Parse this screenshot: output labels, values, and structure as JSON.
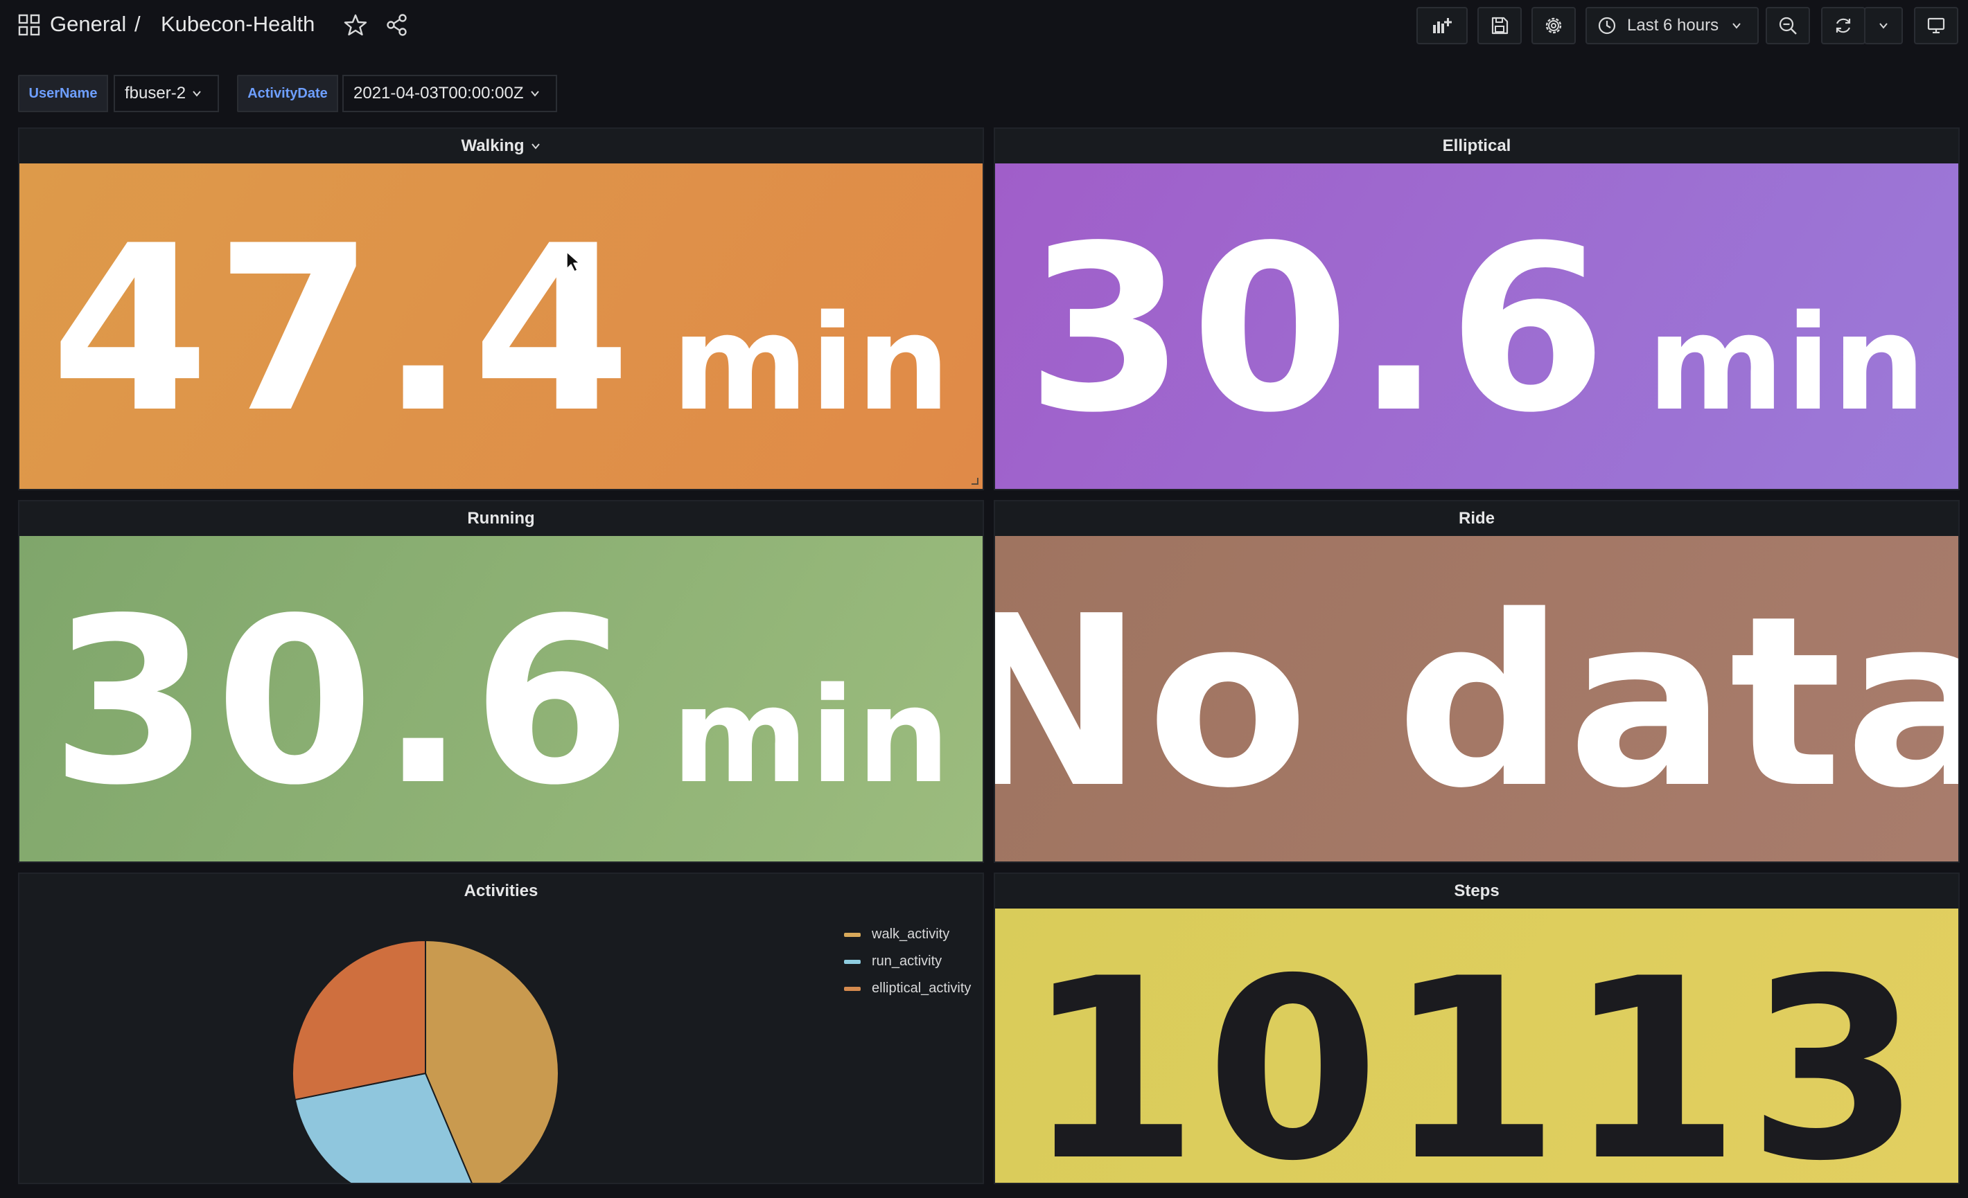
{
  "breadcrumb": {
    "folder": "General",
    "separator": "/",
    "dashboard": "Kubecon-Health"
  },
  "toolbar": {
    "time_range": "Last 6 hours"
  },
  "variables": [
    {
      "label": "UserName",
      "value": "fbuser-2"
    },
    {
      "label": "ActivityDate",
      "value": "2021-04-03T00:00:00Z"
    }
  ],
  "panels": {
    "walking": {
      "title": "Walking",
      "value": "47.4",
      "unit": "min",
      "color": "#e0914a"
    },
    "elliptical": {
      "title": "Elliptical",
      "value": "30.6",
      "unit": "min",
      "color": "#9e6dd2"
    },
    "running": {
      "title": "Running",
      "value": "30.6",
      "unit": "min",
      "color": "#8eb075"
    },
    "ride": {
      "title": "Ride",
      "value": "No data",
      "color": "#a47866"
    },
    "activities": {
      "title": "Activities",
      "legend": [
        {
          "name": "walk_activity",
          "color": "#d8a95a"
        },
        {
          "name": "run_activity",
          "color": "#8ecde0"
        },
        {
          "name": "elliptical_activity",
          "color": "#d48a4e"
        }
      ]
    },
    "steps": {
      "title": "Steps",
      "value": "10113",
      "color": "#ddcd5d"
    }
  },
  "chart_data": {
    "type": "pie",
    "title": "Activities",
    "categories": [
      "walk_activity",
      "run_activity",
      "elliptical_activity"
    ],
    "values": [
      47.4,
      30.6,
      30.6
    ],
    "colors": [
      "#c99a4f",
      "#8fc6dd",
      "#cf6f3e"
    ],
    "legend_position": "top-right"
  }
}
